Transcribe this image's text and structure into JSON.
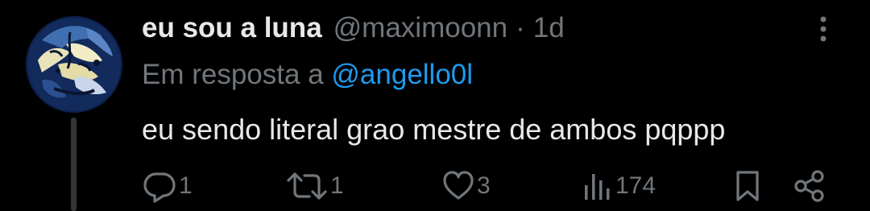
{
  "tweet": {
    "display_name": "eu sou a luna",
    "handle": "@maximoonn",
    "separator": "·",
    "time": "1d",
    "reply_prefix": "Em resposta a",
    "reply_mention": "@angello0l",
    "text": "eu sendo literal grao mestre de ambos pqppp"
  },
  "actions": {
    "replies": "1",
    "retweets": "1",
    "likes": "3",
    "views": "174"
  },
  "colors": {
    "background": "#000000",
    "text_primary": "#e7e9ea",
    "text_secondary": "#71767b",
    "link": "#1d9bf0",
    "thread_line": "#333639"
  },
  "icons": [
    "more-vertical-icon",
    "reply-icon",
    "retweet-icon",
    "like-icon",
    "views-icon",
    "bookmark-icon",
    "share-icon"
  ]
}
